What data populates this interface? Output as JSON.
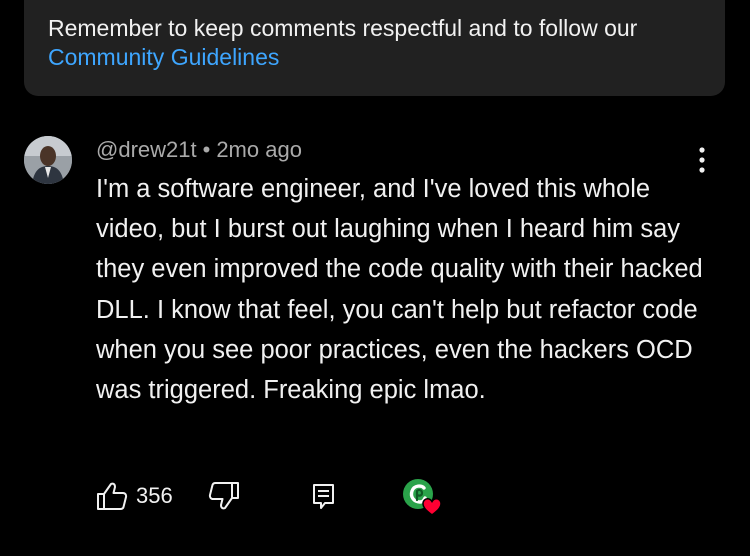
{
  "notice": {
    "text": "Remember to keep comments respectful and to follow our ",
    "link_label": "Community Guidelines"
  },
  "comment": {
    "author": "@drew21t",
    "separator": "•",
    "time": "2mo ago",
    "text": "I'm a software engineer, and I've loved this whole video, but I burst out laughing when I heard him say they even improved the code quality with their hacked DLL. I know that feel, you can't help but refactor code when you see poor practices, even the hackers OCD was triggered. Freaking epic lmao.",
    "likes": "356"
  },
  "icons": {
    "more": "more-vertical-icon",
    "like": "thumbs-up-icon",
    "dislike": "thumbs-down-icon",
    "reply": "reply-comment-icon",
    "creator_heart": "creator-heart-icon"
  },
  "colors": {
    "background": "#000000",
    "notice_bg": "#212121",
    "link": "#3ea6ff",
    "text_primary": "#f1f1f1",
    "text_secondary": "#aaaaaa",
    "heart": "#ff0033",
    "creator_badge": "#2aa34a"
  }
}
